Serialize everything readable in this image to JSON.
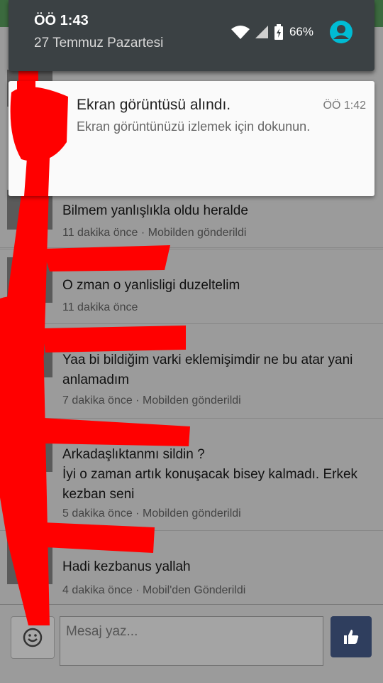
{
  "status_bar": {
    "time": "ÖÖ 1:43",
    "date": "27 Temmuz Pazartesi",
    "battery": "66%"
  },
  "notification": {
    "title": "Ekran görüntüsü alındı.",
    "time": "ÖÖ 1:42",
    "body": "Ekran görüntünüzü izlemek için dokunun."
  },
  "messages": [
    {
      "text": "Bilmem yanlışlıkla oldu heralde",
      "meta": "11 dakika önce · Mobilden gönderildi"
    },
    {
      "text": "O zman o yanlisligi duzeltelim",
      "meta": "11 dakika önce"
    },
    {
      "text": "Yaa bi bildiğim varki eklemişimdir ne bu atar yani anlamadım",
      "meta": "7 dakika önce · Mobilden gönderildi"
    },
    {
      "text": "Arkadaşlıktanmı sildin ?\nİyi o zaman artık konuşacak bisey kalmadı. Erkek kezban seni",
      "meta": "5 dakika önce · Mobilden gönderildi"
    },
    {
      "text": "Hadi kezbanus yallah",
      "meta": "4 dakika önce · Mobil'den Gönderildi"
    }
  ],
  "composer": {
    "placeholder": "Mesaj yaz..."
  },
  "colors": {
    "scribble": "#ff0000",
    "like_button": "#2f3e5e",
    "accent_user": "#00bcd4"
  }
}
